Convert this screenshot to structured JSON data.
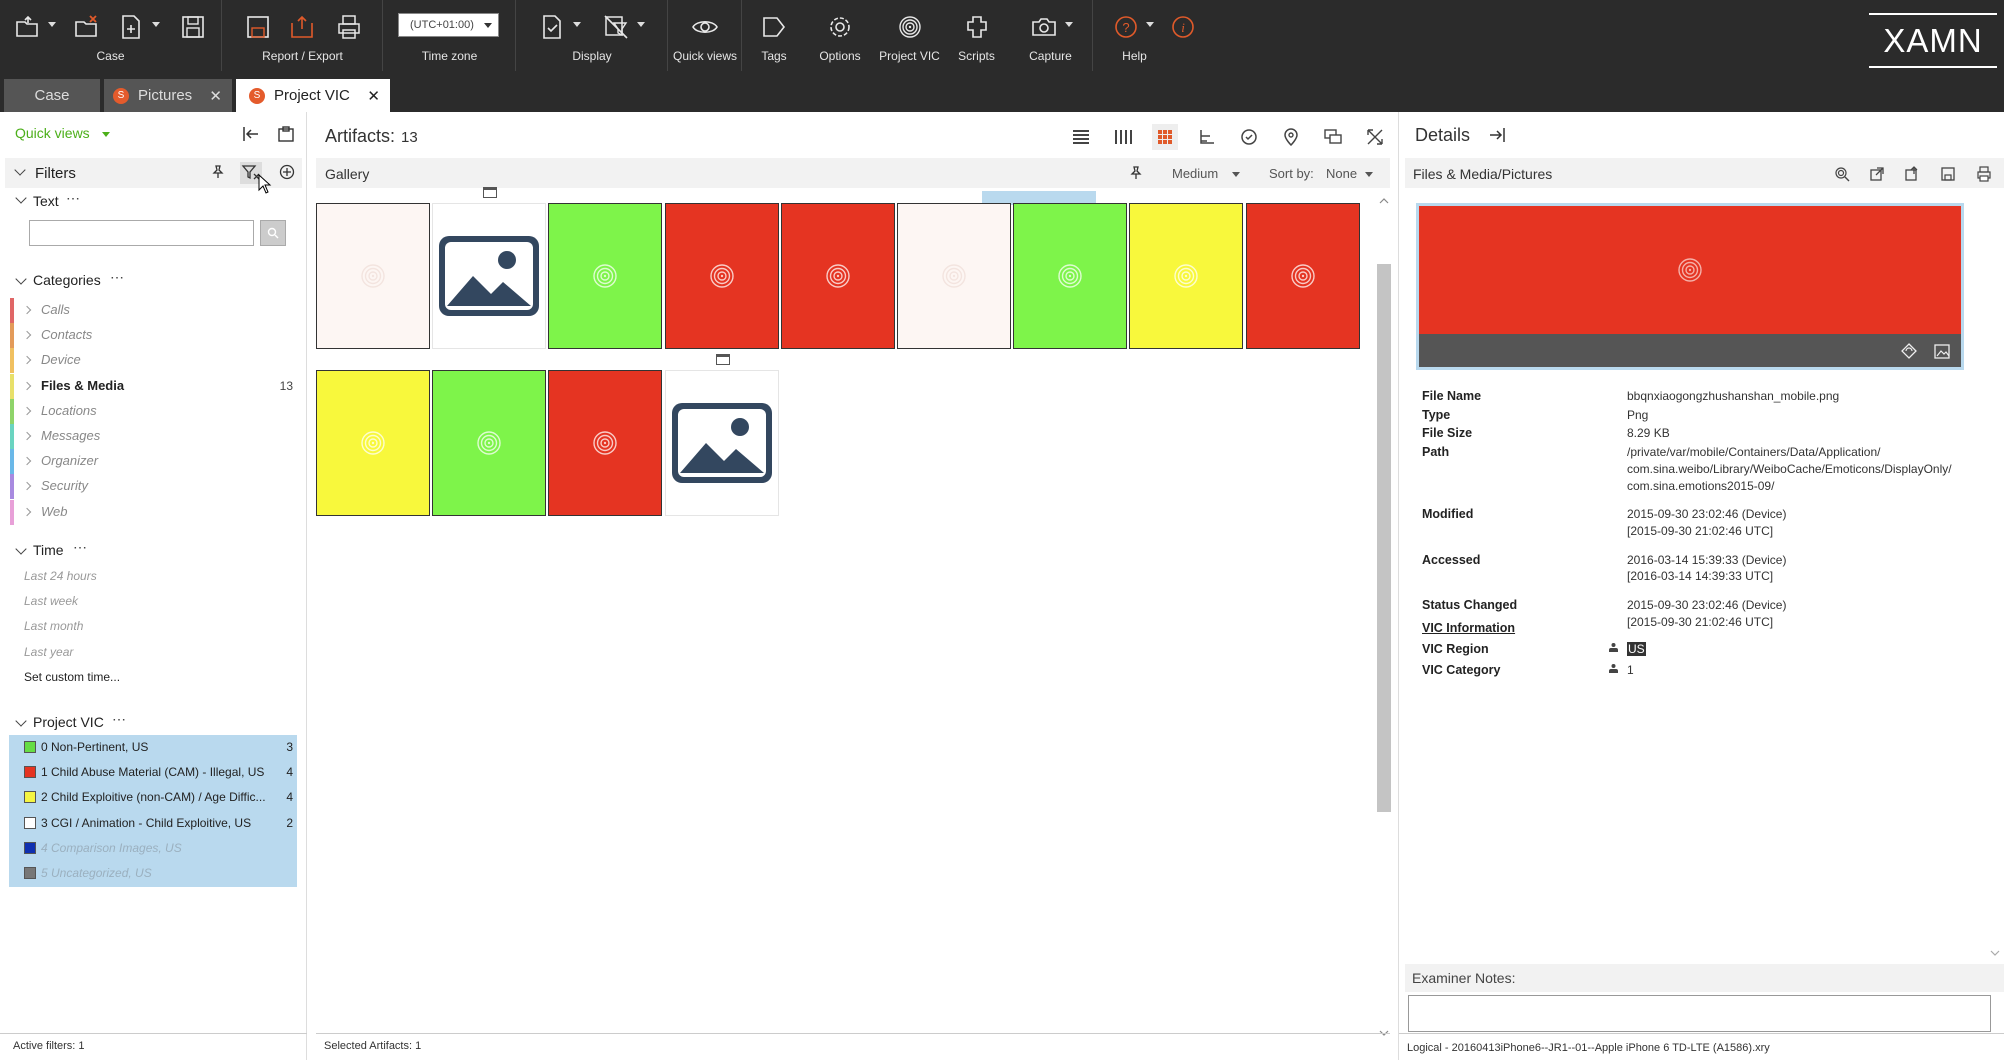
{
  "toolbar": {
    "groups": {
      "case": "Case",
      "report_export": "Report / Export",
      "time_zone": "Time zone",
      "display": "Display",
      "quick_views": "Quick views",
      "tags": "Tags",
      "options": "Options",
      "project_vic": "Project VIC",
      "scripts": "Scripts",
      "capture": "Capture",
      "help": "Help"
    },
    "time_zone_value": "(UTC+01:00)",
    "logo": "XAMN"
  },
  "tabs": [
    {
      "label": "Case"
    },
    {
      "label": "Pictures",
      "badge": "S"
    },
    {
      "label": "Project VIC",
      "badge": "S"
    }
  ],
  "left_panel": {
    "quick_views": "Quick views",
    "filters": "Filters",
    "text_section": "Text",
    "dots": "⋯",
    "categories_title": "Categories",
    "categories": [
      {
        "label": "Calls",
        "color": "#e06666",
        "count": ""
      },
      {
        "label": "Contacts",
        "color": "#e39b5a",
        "count": ""
      },
      {
        "label": "Device",
        "color": "#f0c060",
        "count": ""
      },
      {
        "label": "Files & Media",
        "color": "#e8e06a",
        "count": "13"
      },
      {
        "label": "Locations",
        "color": "#8fd46a",
        "count": ""
      },
      {
        "label": "Messages",
        "color": "#6ad4c0",
        "count": ""
      },
      {
        "label": "Organizer",
        "color": "#6ab8e8",
        "count": ""
      },
      {
        "label": "Security",
        "color": "#a88ae0",
        "count": ""
      },
      {
        "label": "Web",
        "color": "#e8a0d8",
        "count": ""
      }
    ],
    "time_title": "Time",
    "time_items": [
      "Last 24 hours",
      "Last week",
      "Last month",
      "Last year",
      "Set custom time..."
    ],
    "project_vic_title": "Project VIC",
    "vic_items": [
      {
        "label": "0 Non-Pertinent, US",
        "color": "#66dd44",
        "count": "3"
      },
      {
        "label": "1 Child Abuse Material (CAM) - Illegal, US",
        "color": "#e53422",
        "count": "4"
      },
      {
        "label": "2 Child Exploitive (non-CAM) / Age Diffic...",
        "color": "#f5f542",
        "count": "4"
      },
      {
        "label": "3 CGI / Animation - Child Exploitive, US",
        "color": "#ffffff",
        "count": "2"
      },
      {
        "label": "4 Comparison Images, US",
        "color": "#1030b0",
        "count": ""
      },
      {
        "label": "5 Uncategorized, US",
        "color": "#777777",
        "count": ""
      }
    ],
    "active_filters": "Active filters: 1"
  },
  "center": {
    "artifacts_label": "Artifacts:",
    "artifacts_count": "13",
    "gallery_label": "Gallery",
    "size": "Medium",
    "sort_by_label": "Sort by:",
    "sort_by_value": "None",
    "selected_artifacts": "Selected Artifacts: 1",
    "thumbnails": [
      {
        "kind": "color",
        "color": "#fdf6f3"
      },
      {
        "kind": "picture"
      },
      {
        "kind": "color",
        "color": "#7ef44a"
      },
      {
        "kind": "color",
        "color": "#e53422",
        "selected": true
      },
      {
        "kind": "color",
        "color": "#e53422"
      },
      {
        "kind": "color",
        "color": "#fdf6f3"
      },
      {
        "kind": "color",
        "color": "#7ef44a"
      },
      {
        "kind": "color",
        "color": "#f8f83c"
      },
      {
        "kind": "color",
        "color": "#e53422"
      },
      {
        "kind": "color",
        "color": "#f8f83c"
      },
      {
        "kind": "color",
        "color": "#7ef44a"
      },
      {
        "kind": "color",
        "color": "#e53422"
      },
      {
        "kind": "picture"
      }
    ]
  },
  "details": {
    "title": "Details",
    "subtitle": "Files & Media/Pictures",
    "properties": [
      {
        "label": "File Name",
        "lines": [
          "bbqnxiaogongzhushanshan_mobile.png"
        ]
      },
      {
        "label": "Type",
        "lines": [
          "Png"
        ]
      },
      {
        "label": "File Size",
        "lines": [
          "8.29 KB"
        ]
      },
      {
        "label": "Path",
        "lines": [
          "/private/var/mobile/Containers/Data/Application/",
          "com.sina.weibo/Library/WeiboCache/Emoticons/DisplayOnly/",
          "com.sina.emotions2015-09/"
        ]
      },
      {
        "label": "Modified",
        "lines": [
          "2015-09-30 23:02:46 (Device)",
          "[2015-09-30 21:02:46 UTC]"
        ]
      },
      {
        "label": "Accessed",
        "lines": [
          "2016-03-14 15:39:33 (Device)",
          "[2016-03-14 14:39:33 UTC]"
        ]
      },
      {
        "label": "Status Changed",
        "lines": [
          "2015-09-30 23:02:46 (Device)",
          "[2015-09-30 21:02:46 UTC]"
        ]
      }
    ],
    "vic_info": "VIC Information",
    "vic_region_label": "VIC Region",
    "vic_region_value": "US",
    "vic_category_label": "VIC Category",
    "vic_category_value": "1",
    "examiner_notes": "Examiner Notes:",
    "logical_path": "Logical - 20160413iPhone6--JR1--01--Apple iPhone 6 TD-LTE (A1586).xry"
  }
}
